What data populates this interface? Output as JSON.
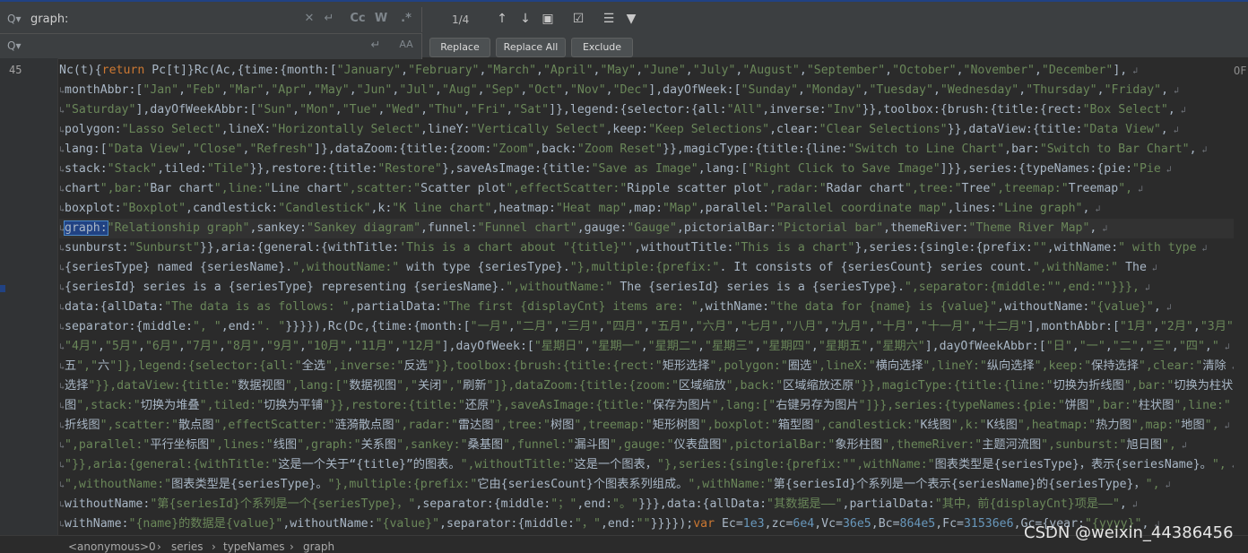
{
  "search": {
    "value": "graph:",
    "replace_value": "",
    "match_count": "1/4"
  },
  "search_icons": {
    "find": "search-history-icon",
    "clear": "clear-icon",
    "newline": "newline-icon",
    "case": "Cc",
    "words": "W",
    "regex": ".*",
    "replace_newline": "newline-icon",
    "preserve_case": "AA"
  },
  "toolbar_icons": [
    "prev-occurrence-icon",
    "next-occurrence-icon",
    "select-all-occurrences-icon",
    "open-in-window-icon",
    "filter-icon",
    "funnel-icon"
  ],
  "buttons": {
    "replace": "Replace",
    "replace_all": "Replace All",
    "exclude": "Exclude"
  },
  "editor": {
    "line_number": "45",
    "right_edge": "OF"
  },
  "breadcrumbs": [
    "<anonymous>0",
    "series",
    "typeNames",
    "graph"
  ],
  "watermark": "CSDN @weixin_44386456",
  "code_lines": [
    "Nc(t){return Pc[t]}Rc(Ac,{time:{month:[\"January\",\"February\",\"March\",\"April\",\"May\",\"June\",\"July\",\"August\",\"September\",\"October\",\"November\",\"December\"],",
    "monthAbbr:[\"Jan\",\"Feb\",\"Mar\",\"Apr\",\"May\",\"Jun\",\"Jul\",\"Aug\",\"Sep\",\"Oct\",\"Nov\",\"Dec\"],dayOfWeek:[\"Sunday\",\"Monday\",\"Tuesday\",\"Wednesday\",\"Thursday\",\"Friday\",",
    "\"Saturday\"],dayOfWeekAbbr:[\"Sun\",\"Mon\",\"Tue\",\"Wed\",\"Thu\",\"Fri\",\"Sat\"]},legend:{selector:{all:\"All\",inverse:\"Inv\"}},toolbox:{brush:{title:{rect:\"Box Select\",",
    "polygon:\"Lasso Select\",lineX:\"Horizontally Select\",lineY:\"Vertically Select\",keep:\"Keep Selections\",clear:\"Clear Selections\"}},dataView:{title:\"Data View\",",
    "lang:[\"Data View\",\"Close\",\"Refresh\"]},dataZoom:{title:{zoom:\"Zoom\",back:\"Zoom Reset\"}},magicType:{title:{line:\"Switch to Line Chart\",bar:\"Switch to Bar Chart\",",
    "stack:\"Stack\",tiled:\"Tile\"}},restore:{title:\"Restore\"},saveAsImage:{title:\"Save as Image\",lang:[\"Right Click to Save Image\"]}},series:{typeNames:{pie:\"Pie",
    "chart\",bar:\"Bar chart\",line:\"Line chart\",scatter:\"Scatter plot\",effectScatter:\"Ripple scatter plot\",radar:\"Radar chart\",tree:\"Tree\",treemap:\"Treemap\",",
    "boxplot:\"Boxplot\",candlestick:\"Candlestick\",k:\"K line chart\",heatmap:\"Heat map\",map:\"Map\",parallel:\"Parallel coordinate map\",lines:\"Line graph\",",
    "graph:\"Relationship graph\",sankey:\"Sankey diagram\",funnel:\"Funnel chart\",gauge:\"Gauge\",pictorialBar:\"Pictorial bar\",themeRiver:\"Theme River Map\",",
    "sunburst:\"Sunburst\"}},aria:{general:{withTitle:'This is a chart about \"{title}\"',withoutTitle:\"This is a chart\"},series:{single:{prefix:\"\",withName:\" with type",
    "{seriesType} named {seriesName}.\",withoutName:\" with type {seriesType}.\"},multiple:{prefix:\". It consists of {seriesCount} series count.\",withName:\" The",
    "{seriesId} series is a {seriesType} representing {seriesName}.\",withoutName:\" The {seriesId} series is a {seriesType}.\",separator:{middle:\"\",end:\"\"}}},",
    "data:{allData:\"The data is as follows: \",partialData:\"The first {displayCnt} items are: \",withName:\"the data for {name} is {value}\",withoutName:\"{value}\",",
    "separator:{middle:\", \",end:\". \"}}}}),Rc(Dc,{time:{month:[\"一月\",\"二月\",\"三月\",\"四月\",\"五月\",\"六月\",\"七月\",\"八月\",\"九月\",\"十月\",\"十一月\",\"十二月\"],monthAbbr:[\"1月\",\"2月\",\"3月\",",
    "\"4月\",\"5月\",\"6月\",\"7月\",\"8月\",\"9月\",\"10月\",\"11月\",\"12月\"],dayOfWeek:[\"星期日\",\"星期一\",\"星期二\",\"星期三\",\"星期四\",\"星期五\",\"星期六\"],dayOfWeekAbbr:[\"日\",\"一\",\"二\",\"三\",\"四\",\"",
    "五\",\"六\"]},legend:{selector:{all:\"全选\",inverse:\"反选\"}},toolbox:{brush:{title:{rect:\"矩形选择\",polygon:\"圈选\",lineX:\"横向选择\",lineY:\"纵向选择\",keep:\"保持选择\",clear:\"清除",
    "选择\"}},dataView:{title:\"数据视图\",lang:[\"数据视图\",\"关闭\",\"刷新\"]},dataZoom:{title:{zoom:\"区域缩放\",back:\"区域缩放还原\"}},magicType:{title:{line:\"切换为折线图\",bar:\"切换为柱状",
    "图\",stack:\"切换为堆叠\",tiled:\"切换为平铺\"}},restore:{title:\"还原\"},saveAsImage:{title:\"保存为图片\",lang:[\"右键另存为图片\"]}},series:{typeNames:{pie:\"饼图\",bar:\"柱状图\",line:\"",
    "折线图\",scatter:\"散点图\",effectScatter:\"涟漪散点图\",radar:\"雷达图\",tree:\"树图\",treemap:\"矩形树图\",boxplot:\"箱型图\",candlestick:\"K线图\",k:\"K线图\",heatmap:\"热力图\",map:\"地图\",",
    "\",parallel:\"平行坐标图\",lines:\"线图\",graph:\"关系图\",sankey:\"桑基图\",funnel:\"漏斗图\",gauge:\"仪表盘图\",pictorialBar:\"象形柱图\",themeRiver:\"主题河流图\",sunburst:\"旭日图\",",
    "\"}},aria:{general:{withTitle:\"这是一个关于“{title}”的图表。\",withoutTitle:\"这是一个图表，\"},series:{single:{prefix:\"\",withName:\"图表类型是{seriesType}，表示{seriesName}。\",",
    "\",withoutName:\"图表类型是{seriesType}。\"},multiple:{prefix:\"它由{seriesCount}个图表系列组成。\",withName:\"第{seriesId}个系列是一个表示{seriesName}的{seriesType}，\",",
    "withoutName:\"第{seriesId}个系列是一个{seriesType}，\",separator:{middle:\"；\",end:\"。\"}}},data:{allData:\"其数据是——\",partialData:\"其中，前{displayCnt}项是——\",",
    "withName:\"{name}的数据是{value}\",withoutName:\"{value}\",separator:{middle:\"，\",end:\"\"}}}});var Ec=1e3,zc=6e4,Vc=36e5,Bc=864e5,Fc=31536e6,Gc={year:\"{yyyy}\","
  ]
}
